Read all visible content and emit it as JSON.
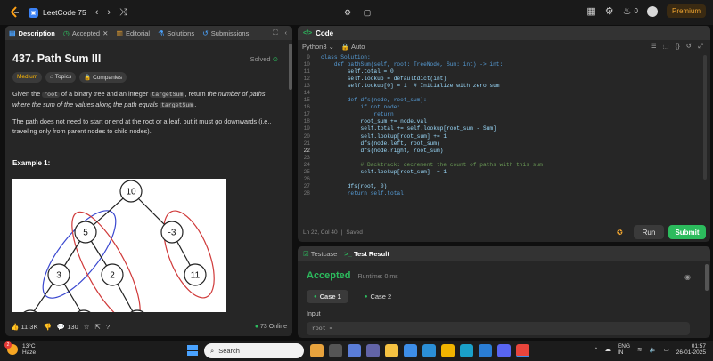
{
  "topbar": {
    "problem_list": "LeetCode 75",
    "streak": "0",
    "premium": "Premium"
  },
  "left_tabs": [
    {
      "label": "Description"
    },
    {
      "label": "Accepted"
    },
    {
      "label": "Editorial"
    },
    {
      "label": "Solutions"
    },
    {
      "label": "Submissions"
    }
  ],
  "problem": {
    "title": "437. Path Sum III",
    "solved": "Solved",
    "difficulty": "Medium",
    "topics": "Topics",
    "companies": "Companies",
    "p1_a": "Given the ",
    "p1_root": "root",
    "p1_b": " of a binary tree and an integer ",
    "p1_target": "targetSum",
    "p1_c": ", return ",
    "p1_em": "the number of paths where the sum of the values along the path equals",
    "p1_target2": "targetSum",
    "p1_d": ".",
    "p2": "The path does not need to start or end at the root or a leaf, but it must go downwards (i.e., traveling only from parent nodes to child nodes).",
    "example_title": "Example 1:",
    "tree_nodes": [
      "10",
      "5",
      "-3",
      "3",
      "2",
      "11"
    ]
  },
  "left_footer": {
    "likes": "11.3K",
    "comments": "130",
    "online": "73 Online"
  },
  "code_panel": {
    "title": "Code",
    "language": "Python3",
    "auto": "Auto",
    "lines": [
      {
        "n": "9",
        "t": "class Solution:"
      },
      {
        "n": "10",
        "t": "    def pathSum(self, root: TreeNode, Sum: int) -> int:"
      },
      {
        "n": "11",
        "t": "        self.total = 0"
      },
      {
        "n": "12",
        "t": "        self.lookup = defaultdict(int)"
      },
      {
        "n": "13",
        "t": "        self.lookup[0] = 1  # Initialize with zero sum"
      },
      {
        "n": "14",
        "t": ""
      },
      {
        "n": "15",
        "t": "        def dfs(node, root_sum):"
      },
      {
        "n": "16",
        "t": "            if not node:"
      },
      {
        "n": "17",
        "t": "                return"
      },
      {
        "n": "18",
        "t": "            root_sum += node.val"
      },
      {
        "n": "19",
        "t": "            self.total += self.lookup[root_sum - Sum]"
      },
      {
        "n": "20",
        "t": "            self.lookup[root_sum] += 1"
      },
      {
        "n": "21",
        "t": "            dfs(node.left, root_sum)"
      },
      {
        "n": "22",
        "t": "            dfs(node.right, root_sum)"
      },
      {
        "n": "23",
        "t": ""
      },
      {
        "n": "24",
        "t": "            # Backtrack: decrement the count of paths with this sum"
      },
      {
        "n": "25",
        "t": "            self.lookup[root_sum] -= 1"
      },
      {
        "n": "26",
        "t": ""
      },
      {
        "n": "27",
        "t": "        dfs(root, 0)"
      },
      {
        "n": "28",
        "t": "        return self.total"
      }
    ],
    "cursor": "Ln 22, Col 40",
    "saved": "Saved",
    "run": "Run",
    "submit": "Submit"
  },
  "result": {
    "tab_testcase": "Testcase",
    "tab_result": "Test Result",
    "status": "Accepted",
    "runtime": "Runtime: 0 ms",
    "case1": "Case 1",
    "case2": "Case 2",
    "input_label": "Input",
    "input_value": "root ="
  },
  "taskbar": {
    "temp": "13°C",
    "weather": "Haze",
    "weather_badge": "2",
    "search": "Search",
    "lang1": "ENG",
    "lang2": "IN",
    "time": "01:57",
    "date": "26-01-2025"
  }
}
